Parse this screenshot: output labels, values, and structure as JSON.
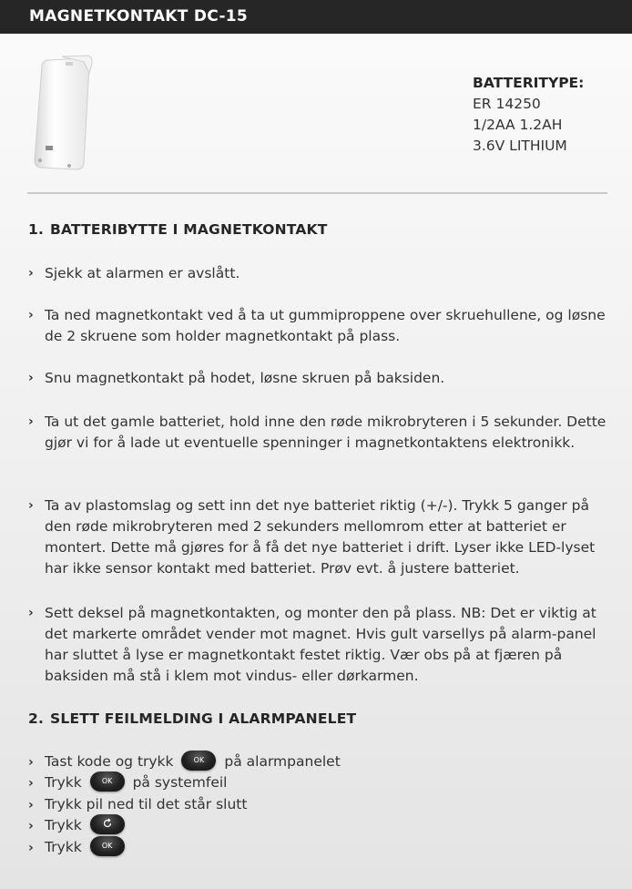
{
  "header": {
    "title": "MAGNETKONTAKT DC-15"
  },
  "battery": {
    "title": "BATTERITYPE:",
    "lines": [
      "ER 14250",
      "1/2AA 1.2AH",
      "3.6V LITHIUM"
    ]
  },
  "section1": {
    "number": "1.",
    "title": "BATTERIBYTTE I MAGNETKONTAKT",
    "bullets": [
      "Sjekk at alarmen er avslått.",
      "Ta ned magnetkontakt ved å ta ut gummiproppene over skruehullene, og løsne de 2 skruene som holder magnetkontakt på plass.",
      "Snu magnetkontakt på hodet, løsne skruen på baksiden.",
      "Ta ut det gamle batteriet, hold inne den røde mikrobryteren i 5 sekunder. Dette gjør vi for å lade ut eventuelle spenninger i magnetkontaktens elektronikk.",
      "Ta av plastomslag og sett inn det nye batteriet riktig (+/-). Trykk 5 ganger på den røde mikrobryteren med 2 sekunders mellomrom etter at batteriet er montert. Dette må gjøres for å få det nye batteriet i drift. Lyser ikke LED-lyset har ikke sensor kontakt med batteriet. Prøv evt. å justere batteriet.",
      "Sett deksel på magnetkontakten, og monter den på plass. NB: Det er viktig at det markerte området vender mot magnet. Hvis gult varsellys på alarm-panel har sluttet å lyse er magnetkontakt festet riktig. Vær obs på at fjæren på baksiden må stå i klem mot vindus- eller dørkarmen."
    ]
  },
  "section2": {
    "number": "2.",
    "title": "SLETT FEILMELDING I ALARMPANELET",
    "steps": [
      {
        "before": "Tast kode og trykk",
        "after": "på alarmpanelet"
      },
      {
        "before": "Trykk",
        "after": "på systemfeil"
      },
      {
        "before": "Trykk pil ned til det står slutt",
        "after": ""
      },
      {
        "before": "Trykk",
        "after": ""
      },
      {
        "before": "Trykk",
        "after": ""
      }
    ]
  },
  "arrow_glyph": "›",
  "key_ok_label": "OK",
  "icons": {
    "back_key": "back-arrow-key-icon",
    "ok_key": "ok-key-icon"
  },
  "colors": {
    "header_bg": "#262626",
    "header_text": "#ffffff",
    "text": "#333333"
  }
}
